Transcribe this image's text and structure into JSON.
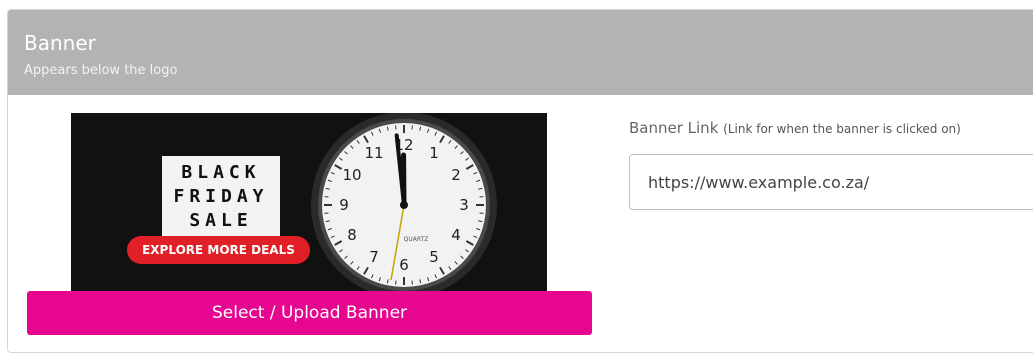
{
  "panel": {
    "title": "Banner",
    "subtitle": "Appears below the logo"
  },
  "banner_preview": {
    "card_lines": [
      "BLACK",
      "FRIDAY",
      "SALE"
    ],
    "deals_label": "EXPLORE MORE DEALS",
    "clock_numbers": [
      "12",
      "1",
      "2",
      "3",
      "4",
      "5",
      "6",
      "7",
      "8",
      "9",
      "10",
      "11"
    ],
    "clock_brand": "QUARTZ",
    "clock_time": "11:59"
  },
  "select_button": {
    "label": "Select / Upload Banner"
  },
  "banner_link": {
    "label": "Banner Link",
    "hint": "(Link for when the banner is clicked on)",
    "value": "https://www.example.co.za/"
  },
  "colors": {
    "header_bg": "#b3b3b3",
    "button_bg": "#e6068f",
    "deals_pill": "#e01f26"
  }
}
